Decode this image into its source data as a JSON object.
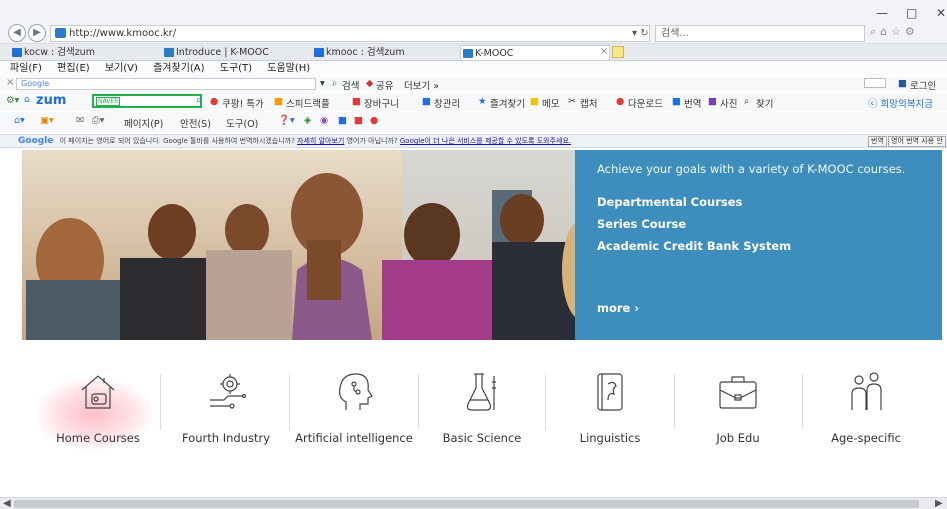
{
  "browser": {
    "url": "http://www.kmooc.kr/",
    "search_placeholder": "검색...",
    "refresh_glyph": "▾ ↻",
    "window_controls": [
      "—",
      "□",
      "✕"
    ],
    "tabs": [
      {
        "label": "kocw : 검색zum",
        "fav_color": "#1e6fd9"
      },
      {
        "label": "Introduce | K-MOOC",
        "fav_color": "#2a7cc7"
      },
      {
        "label": "kmooc : 검색zum",
        "fav_color": "#1e6fd9"
      },
      {
        "label": "K-MOOC",
        "fav_color": "#2a7cc7"
      }
    ],
    "menu": [
      "파일(F)",
      "편집(E)",
      "보기(V)",
      "즐겨찾기(A)",
      "도구(T)",
      "도움말(H)"
    ]
  },
  "toolbar1": {
    "close": "×",
    "google_label": "Google",
    "search_label": "검색",
    "share_label": "공유",
    "more_label": "더보기 »",
    "login_label": "로그인"
  },
  "toolbar2": {
    "zum": "zum",
    "naver": "NAVER",
    "items": [
      "쿠팡! 특가",
      "스피드랙플",
      "장바구니",
      "창관리",
      "즐겨찾기",
      "메모",
      "캡처",
      "다운로드",
      "번역",
      "사진",
      "찾기",
      "ⓒ 희망의복지금"
    ]
  },
  "toolbar3": {
    "items": [
      "페이지(P)",
      "안전(S)",
      "도구(O)"
    ]
  },
  "google_translate_bar": {
    "logo": "Google",
    "message": "이 페이지는 영어로 되어 있습니다. Google 툴바를 사용하여 번역하시겠습니까?",
    "link1": "자세히 알아보기",
    "message2": "영어가 아닙니까?",
    "link2": "Google이 더 나은 서비스를 제공할 수 있도록 도와주세요.",
    "btn_translate": "번역",
    "btn_never": "영어 번역 사용 안 함"
  },
  "hero": {
    "tagline": "Achieve your goals with a variety of K-MOOC courses.",
    "links": [
      "Departmental Courses",
      "Series Course",
      "Academic Credit Bank System"
    ],
    "more": "more ›"
  },
  "categories": [
    {
      "label": "Home Courses",
      "icon": "house-icon"
    },
    {
      "label": "Fourth Industry",
      "icon": "gear-circuit-icon"
    },
    {
      "label": "Artificial intelligence",
      "icon": "ai-head-icon"
    },
    {
      "label": "Basic Science",
      "icon": "flask-icon"
    },
    {
      "label": "Linguistics",
      "icon": "book-icon"
    },
    {
      "label": "Job Edu",
      "icon": "briefcase-icon"
    },
    {
      "label": "Age-specific",
      "icon": "people-icon"
    }
  ],
  "colors": {
    "hero_panel": "#3e8ebd",
    "icon_stroke": "#444444"
  }
}
